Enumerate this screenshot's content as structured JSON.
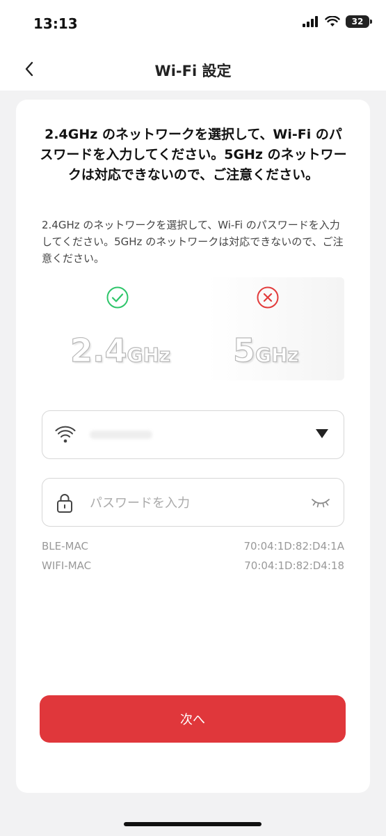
{
  "status_bar": {
    "time": "13:13",
    "battery_level": "32"
  },
  "nav": {
    "title": "Wi-Fi 設定"
  },
  "content": {
    "heading": "2.4GHz のネットワークを選択して、Wi-Fi のパスワードを入力してください。5GHz のネットワークは対応できないので、ご注意ください。",
    "description": "2.4GHz のネットワークを選択して、Wi-Fi のパスワードを入力してください。5GHz のネットワークは対応できないので、ご注意ください。",
    "freq_24": {
      "number": "2.4",
      "unit": "GHz"
    },
    "freq_5": {
      "number": "5",
      "unit": "GHz"
    }
  },
  "password_field": {
    "placeholder": "パスワードを入力"
  },
  "mac": {
    "ble_label": "BLE-MAC",
    "ble_value": "70:04:1D:82:D4:1A",
    "wifi_label": "WIFI-MAC",
    "wifi_value": "70:04:1D:82:D4:18"
  },
  "next_button": {
    "label": "次へ"
  },
  "colors": {
    "accent": "#e0373b",
    "ok": "#2ec56a",
    "error": "#e23b3b"
  },
  "icons": [
    "chevron-left-icon",
    "check-circle-icon",
    "x-circle-icon",
    "wifi-icon",
    "caret-down-icon",
    "lock-icon",
    "eye-closed-icon"
  ]
}
